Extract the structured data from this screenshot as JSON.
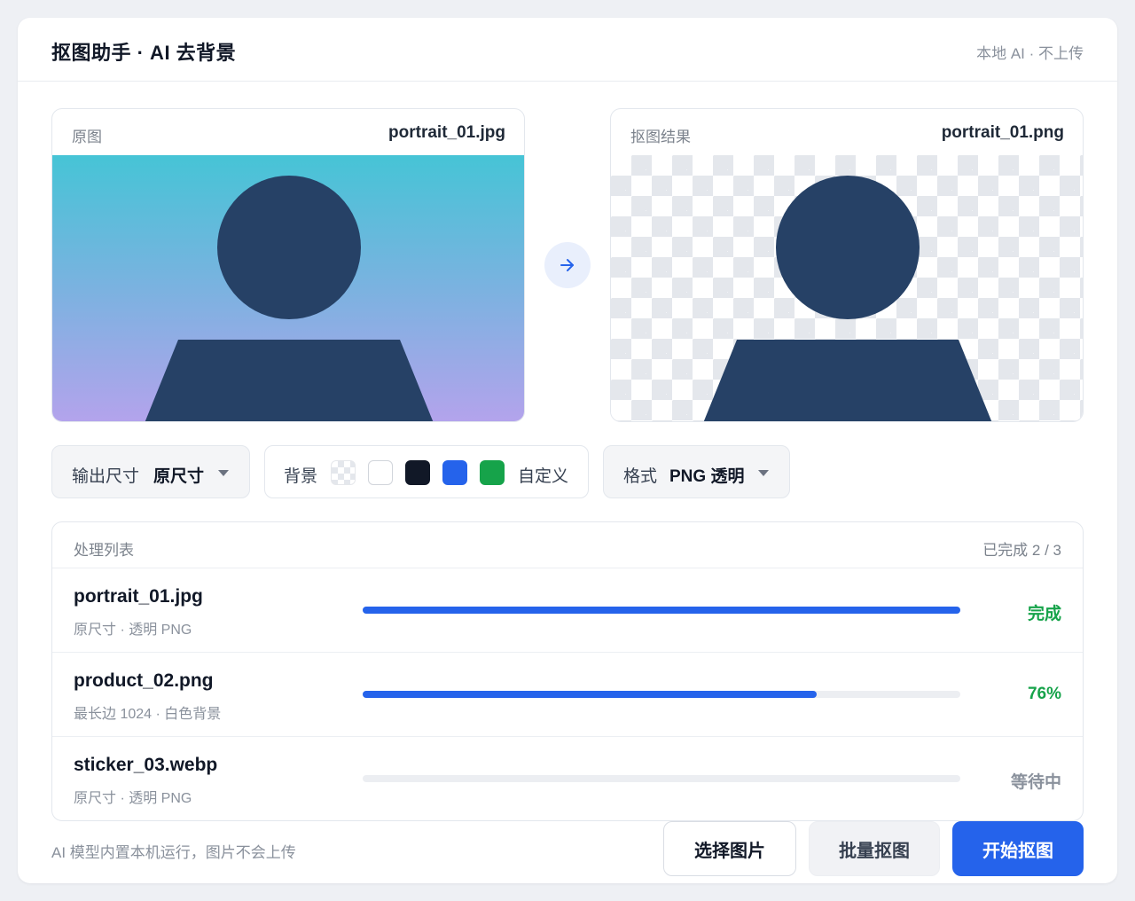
{
  "header": {
    "title": "抠图助手 · AI 去背景",
    "note": "本地 AI · 不上传"
  },
  "preview": {
    "original": {
      "label": "原图",
      "filename": "portrait_01.jpg"
    },
    "result": {
      "label": "抠图结果",
      "filename": "portrait_01.png"
    },
    "arrow_icon": "arrow-right-icon"
  },
  "controls": {
    "size": {
      "label": "输出尺寸",
      "value": "原尺寸"
    },
    "background": {
      "label": "背景",
      "swatches": [
        "transparent",
        "#ffffff",
        "#111827",
        "#2563eb",
        "#16a34a"
      ],
      "custom_label": "自定义"
    },
    "format": {
      "label": "格式",
      "value": "PNG 透明"
    }
  },
  "queue": {
    "title": "处理列表",
    "count": "已完成 2 / 3",
    "items": [
      {
        "name": "portrait_01.jpg",
        "meta": "原尺寸 · 透明 PNG",
        "progress": 1.0,
        "status": "完成",
        "status_color": "#16a34a"
      },
      {
        "name": "product_02.png",
        "meta": "最长边 1024 · 白色背景",
        "progress": 0.76,
        "status": "76%",
        "status_color": "#16a34a"
      },
      {
        "name": "sticker_03.webp",
        "meta": "原尺寸 · 透明 PNG",
        "progress": 0,
        "status": "等待中",
        "status_color": "#8a919c"
      }
    ]
  },
  "footer": {
    "note": "AI 模型内置本机运行，图片不会上传",
    "select_button": "选择图片",
    "batch_button": "批量抠图",
    "start_button": "开始抠图"
  },
  "colors": {
    "accent": "#2563eb",
    "success": "#16a34a",
    "subject": "#264166"
  }
}
